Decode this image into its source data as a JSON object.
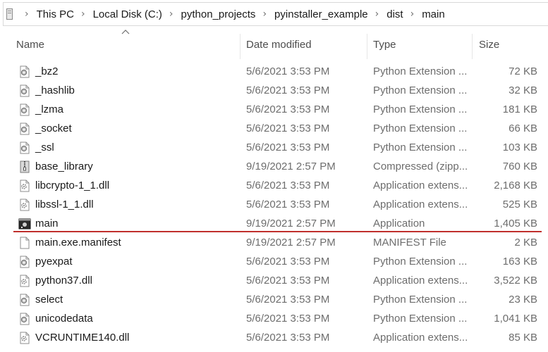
{
  "breadcrumb": [
    "This PC",
    "Local Disk (C:)",
    "python_projects",
    "pyinstaller_example",
    "dist",
    "main"
  ],
  "columns": {
    "name": "Name",
    "date": "Date modified",
    "type": "Type",
    "size": "Size"
  },
  "files": [
    {
      "name": "_bz2",
      "date": "5/6/2021 3:53 PM",
      "type": "Python Extension ...",
      "size": "72 KB",
      "icon": "python-extension-icon"
    },
    {
      "name": "_hashlib",
      "date": "5/6/2021 3:53 PM",
      "type": "Python Extension ...",
      "size": "32 KB",
      "icon": "python-extension-icon"
    },
    {
      "name": "_lzma",
      "date": "5/6/2021 3:53 PM",
      "type": "Python Extension ...",
      "size": "181 KB",
      "icon": "python-extension-icon"
    },
    {
      "name": "_socket",
      "date": "5/6/2021 3:53 PM",
      "type": "Python Extension ...",
      "size": "66 KB",
      "icon": "python-extension-icon"
    },
    {
      "name": "_ssl",
      "date": "5/6/2021 3:53 PM",
      "type": "Python Extension ...",
      "size": "103 KB",
      "icon": "python-extension-icon"
    },
    {
      "name": "base_library",
      "date": "9/19/2021 2:57 PM",
      "type": "Compressed (zipp...",
      "size": "760 KB",
      "icon": "zip-folder-icon"
    },
    {
      "name": "libcrypto-1_1.dll",
      "date": "5/6/2021 3:53 PM",
      "type": "Application extens...",
      "size": "2,168 KB",
      "icon": "dll-file-icon"
    },
    {
      "name": "libssl-1_1.dll",
      "date": "5/6/2021 3:53 PM",
      "type": "Application extens...",
      "size": "525 KB",
      "icon": "dll-file-icon"
    },
    {
      "name": "main",
      "date": "9/19/2021 2:57 PM",
      "type": "Application",
      "size": "1,405 KB",
      "icon": "application-icon"
    },
    {
      "name": "main.exe.manifest",
      "date": "9/19/2021 2:57 PM",
      "type": "MANIFEST File",
      "size": "2 KB",
      "icon": "blank-file-icon"
    },
    {
      "name": "pyexpat",
      "date": "5/6/2021 3:53 PM",
      "type": "Python Extension ...",
      "size": "163 KB",
      "icon": "python-extension-icon"
    },
    {
      "name": "python37.dll",
      "date": "5/6/2021 3:53 PM",
      "type": "Application extens...",
      "size": "3,522 KB",
      "icon": "dll-file-icon"
    },
    {
      "name": "select",
      "date": "5/6/2021 3:53 PM",
      "type": "Python Extension ...",
      "size": "23 KB",
      "icon": "python-extension-icon"
    },
    {
      "name": "unicodedata",
      "date": "5/6/2021 3:53 PM",
      "type": "Python Extension ...",
      "size": "1,041 KB",
      "icon": "python-extension-icon"
    },
    {
      "name": "VCRUNTIME140.dll",
      "date": "5/6/2021 3:53 PM",
      "type": "Application extens...",
      "size": "85 KB",
      "icon": "dll-file-icon"
    }
  ],
  "highlight_color": "#c0302d"
}
